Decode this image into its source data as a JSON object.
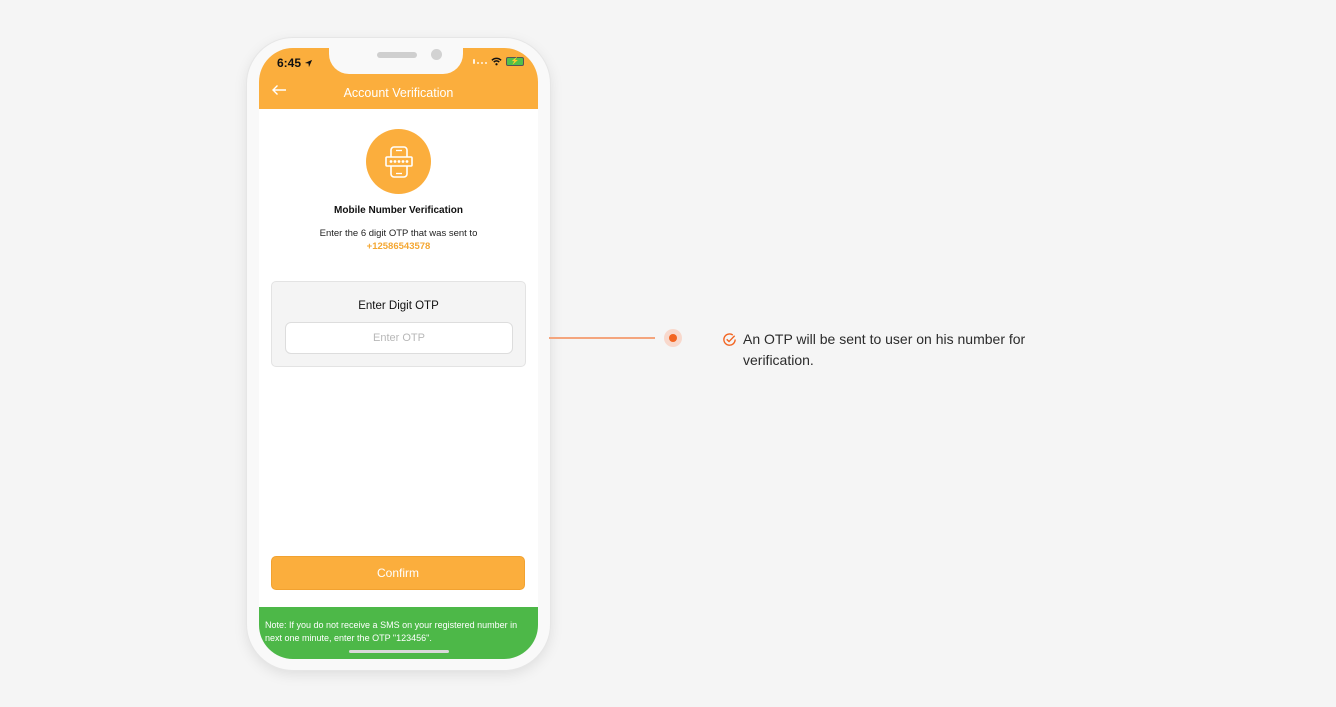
{
  "status_bar": {
    "time": "6:45",
    "location_icon": "location-arrow-icon",
    "wifi_icon": "wifi-icon",
    "battery_icon": "battery-charging-icon"
  },
  "nav": {
    "back_icon": "arrow-left-icon",
    "title": "Account Verification"
  },
  "verification": {
    "icon": "phone-otp-icon",
    "heading": "Mobile Number  Verification",
    "instruction": "Enter the 6 digit OTP that was sent to",
    "phone_number": "+12586543578"
  },
  "otp_form": {
    "label": "Enter Digit OTP",
    "placeholder": "Enter OTP",
    "value": ""
  },
  "confirm_label": "Confirm",
  "note": "Note:  If you do not receive a SMS on your registered number in next one minute, enter the OTP \"123456\".",
  "callout": {
    "icon": "check-circle-icon",
    "text": "An OTP will be sent to user on his number for verification."
  },
  "colors": {
    "primary": "#fbae3d",
    "note_bg": "#4db848",
    "accent": "#f26522"
  }
}
